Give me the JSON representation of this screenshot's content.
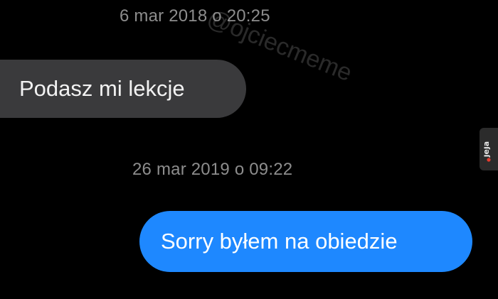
{
  "conversation": {
    "messages": [
      {
        "timestamp": "6 mar 2018 o 20:25",
        "text": "Podasz mi lekcje",
        "direction": "incoming"
      },
      {
        "timestamp": "26 mar 2019 o 09:22",
        "text": "Sorry byłem na obiedzie",
        "direction": "outgoing"
      }
    ]
  },
  "watermark": {
    "text": "@ojciecmeme"
  },
  "logo": {
    "text": "jeja.pl",
    "icon": "jeja-logo-icon"
  },
  "colors": {
    "background": "#000000",
    "incoming_bubble": "#3a3a3c",
    "outgoing_bubble": "#1e88ff",
    "timestamp": "#8d8d8d"
  }
}
